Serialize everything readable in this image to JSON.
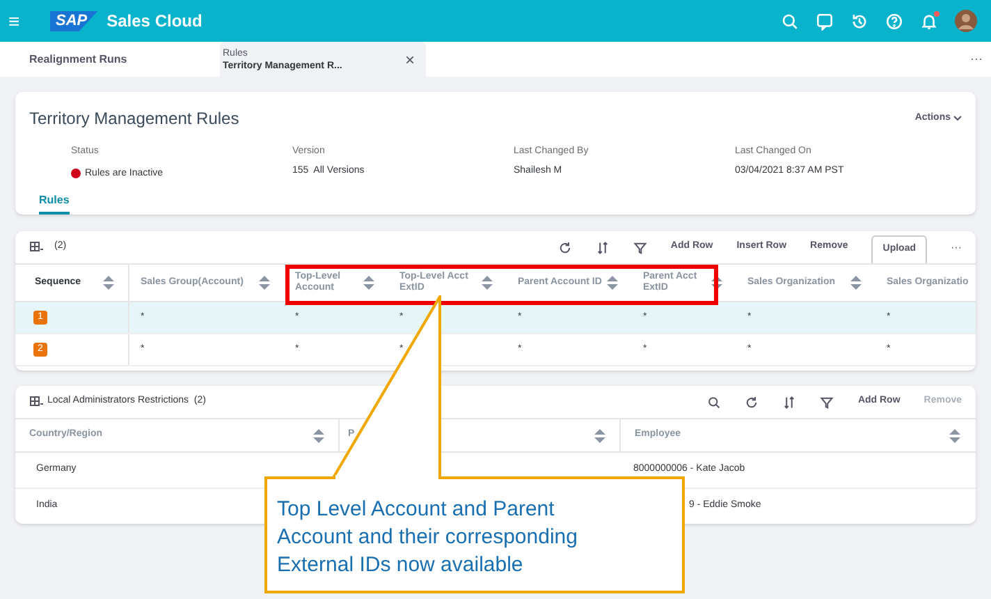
{
  "shell": {
    "menu": "≡",
    "logo": "SAP",
    "product": "Sales Cloud",
    "notification": true
  },
  "tabs": [
    {
      "label": "Realignment Runs",
      "selected": false
    },
    {
      "title": "Rules",
      "label": "Territory Management R...",
      "selected": true,
      "close": "×"
    }
  ],
  "tabs_overflow": "···",
  "header": {
    "title": "Territory Management Rules",
    "actions": "Actions",
    "fields": [
      {
        "label": "Status",
        "value": "Rules are Inactive",
        "color": "#d0021b"
      },
      {
        "label": "Version",
        "value": "155  All Versions"
      },
      {
        "label": "Last Changed By",
        "value": "Shailesh M"
      },
      {
        "label": "Last Changed On",
        "value": "03/04/2021 8:37 AM PST"
      }
    ],
    "section_tab": {
      "label": "Rules",
      "selected": true
    }
  },
  "rules_table": {
    "count": "(2)",
    "buttons": [
      {
        "label": "Add Row",
        "disabled": false
      },
      {
        "label": "Insert Row",
        "disabled": false
      },
      {
        "label": "Remove",
        "disabled": false
      },
      {
        "label": "Upload",
        "disabled": false,
        "kind": "outlined"
      }
    ],
    "overflow": "···",
    "columns": [
      "Sequence",
      "Sales Group(Account)",
      "Top-Level Account",
      "Top-Level Acct ExtID",
      "Parent Account ID",
      "Parent Acct ExtID",
      "Sales Organization",
      "Sales Organizatio"
    ],
    "rows": [
      {
        "selected": true,
        "cells": [
          "1",
          "*",
          "*",
          "*",
          "*",
          "*",
          "*",
          "*"
        ]
      },
      {
        "selected": false,
        "cells": [
          "2",
          "*",
          "*",
          "*",
          "*",
          "*",
          "*",
          "*"
        ]
      }
    ]
  },
  "admin_table": {
    "title": "Local Administrators Restrictions",
    "count": "(2)",
    "buttons": [
      {
        "label": "Add Row",
        "disabled": false
      },
      {
        "label": "Remove",
        "disabled": true
      }
    ],
    "columns": [
      "Country/Region",
      "P",
      "Employee"
    ],
    "rows": [
      {
        "country": "Germany",
        "employee": "8000000006 - Kate Jacob"
      },
      {
        "country": "India",
        "employee": "9 - Eddie Smoke",
        "covered": true
      }
    ]
  },
  "callout": {
    "text": "Top Level Account and Parent Account and their corresponding External IDs now available"
  }
}
